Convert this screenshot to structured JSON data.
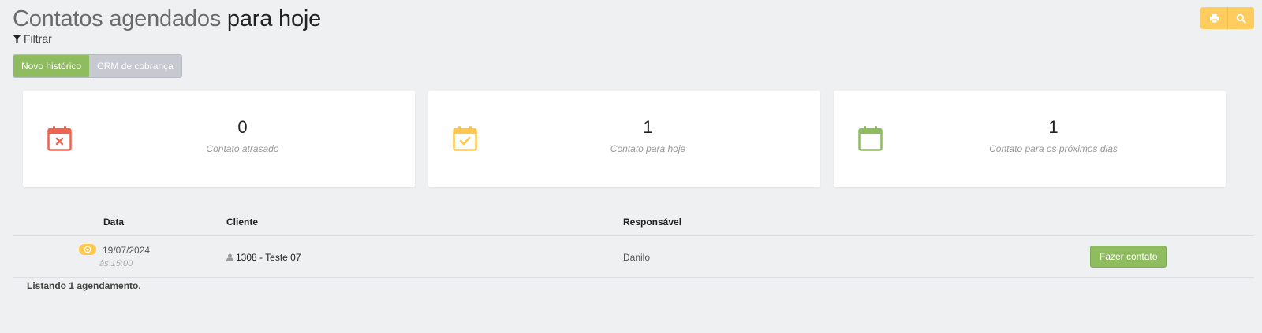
{
  "header": {
    "title_light": "Contatos agendados",
    "title_dark": "para hoje",
    "filter_label": "Filtrar"
  },
  "top_buttons": [
    {
      "icon": "print-icon"
    },
    {
      "icon": "search-icon"
    }
  ],
  "actions": {
    "new_history": "Novo histórico",
    "crm": "CRM de cobrança"
  },
  "cards": [
    {
      "count": "0",
      "label": "Contato atrasado",
      "color": "#ef6450",
      "icon": "calendar-x-icon"
    },
    {
      "count": "1",
      "label": "Contato para hoje",
      "color": "#ffc74d",
      "icon": "calendar-check-icon"
    },
    {
      "count": "1",
      "label": "Contato para os próximos dias",
      "color": "#8fbc5e",
      "icon": "calendar-icon"
    }
  ],
  "table": {
    "columns": [
      "Data",
      "Cliente",
      "Responsável"
    ],
    "rows": [
      {
        "date": "19/07/2024",
        "time": "às 15:00",
        "client": "1308 - Teste 07",
        "responsible": "Danilo",
        "action": "Fazer contato"
      }
    ]
  },
  "footer": "Listando 1 agendamento."
}
